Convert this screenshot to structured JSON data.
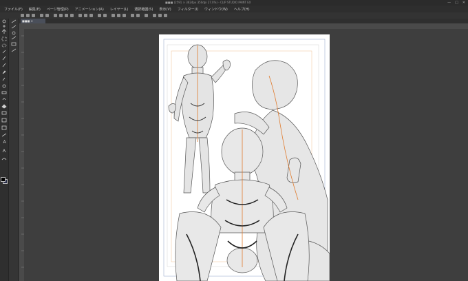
{
  "window": {
    "title": "■■■ (2591 × 3624px 350dpi 27.0%) - CLIP STUDIO PAINT EX",
    "controls": [
      "—",
      "□",
      "✕"
    ]
  },
  "menu": {
    "items": [
      "ファイル(F)",
      "編集(E)",
      "ページ管理(P)",
      "アニメーション(A)",
      "レイヤー(L)",
      "選択範囲(S)",
      "表示(V)",
      "フィルター(I)",
      "ウィンドウ(W)",
      "ヘルプ(H)"
    ]
  },
  "document": {
    "tab_label": "■■■ ×"
  },
  "tools": {
    "items": [
      "zoom-icon",
      "hand-icon",
      "move-icon",
      "select-icon",
      "lasso-icon",
      "eyedropper-icon",
      "pen-icon",
      "pencil-icon",
      "brush-icon",
      "airbrush-icon",
      "decoration-icon",
      "eraser-icon",
      "blend-icon",
      "fill-icon",
      "gradient-icon",
      "figure-icon",
      "frame-icon",
      "ruler-icon",
      "text-icon",
      "balloon-icon",
      "line-correction-icon"
    ],
    "text_tool_glyph": "A"
  },
  "colors": {
    "foreground": "#000000",
    "background": "#2a2f4a",
    "ui_dark": "#2e2e2e",
    "canvas_bg": "#3e3e3e",
    "accent_orange": "#e07a2c"
  }
}
